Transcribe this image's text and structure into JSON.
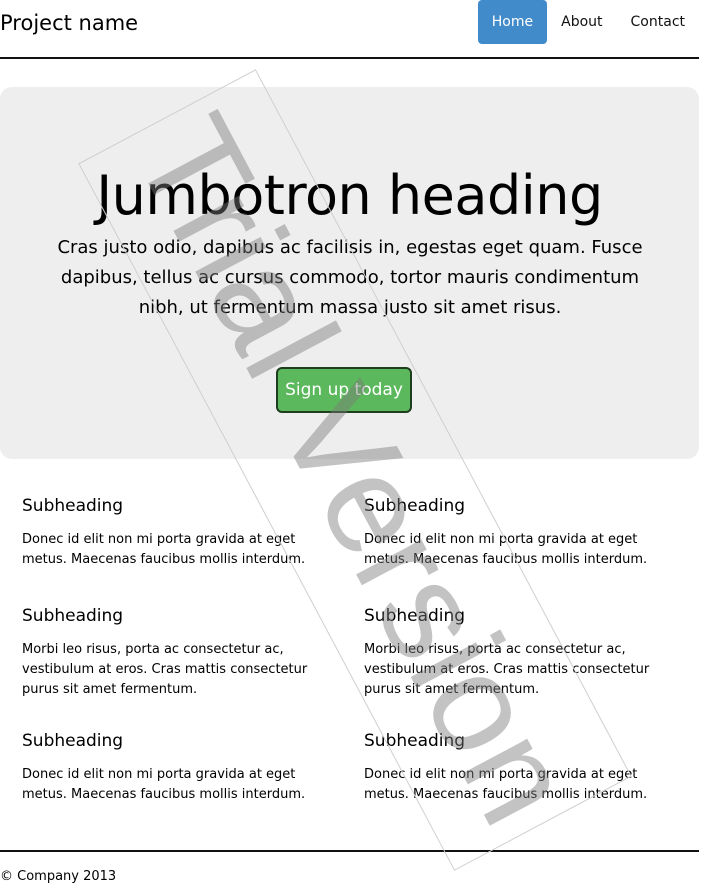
{
  "header": {
    "brand": "Project name",
    "nav": [
      {
        "label": "Home",
        "active": true
      },
      {
        "label": "About",
        "active": false
      },
      {
        "label": "Contact",
        "active": false
      }
    ]
  },
  "jumbotron": {
    "heading": "Jumbotron heading",
    "lead": "Cras justo odio, dapibus ac facilisis in, egestas eget quam. Fusce dapibus, tellus ac cursus commodo, tortor mauris condimentum nibh, ut fermentum massa justo sit amet risus.",
    "button": "Sign up today"
  },
  "sections": {
    "left": [
      {
        "heading": "Subheading",
        "text": "Donec id elit non mi porta gravida at eget metus. Maecenas faucibus mollis interdum."
      },
      {
        "heading": "Subheading",
        "text": "Morbi leo risus, porta ac consectetur ac, vestibulum at eros. Cras mattis consectetur purus sit amet fermentum."
      },
      {
        "heading": "Subheading",
        "text": "Donec id elit non mi porta gravida at eget metus. Maecenas faucibus mollis interdum."
      }
    ],
    "right": [
      {
        "heading": "Subheading",
        "text": "Donec id elit non mi porta gravida at eget metus. Maecenas faucibus mollis interdum."
      },
      {
        "heading": "Subheading",
        "text": "Morbi leo risus, porta ac consectetur ac, vestibulum at eros. Cras mattis consectetur purus sit amet fermentum."
      },
      {
        "heading": "Subheading",
        "text": "Donec id elit non mi porta gravida at eget metus. Maecenas faucibus mollis interdum."
      }
    ]
  },
  "footer": {
    "text": "© Company 2013"
  },
  "watermark": {
    "text": "Trial Version"
  },
  "colors": {
    "nav_active": "#428bca",
    "jumbotron_bg": "#eeeeee",
    "button_bg": "#5cb85c"
  }
}
